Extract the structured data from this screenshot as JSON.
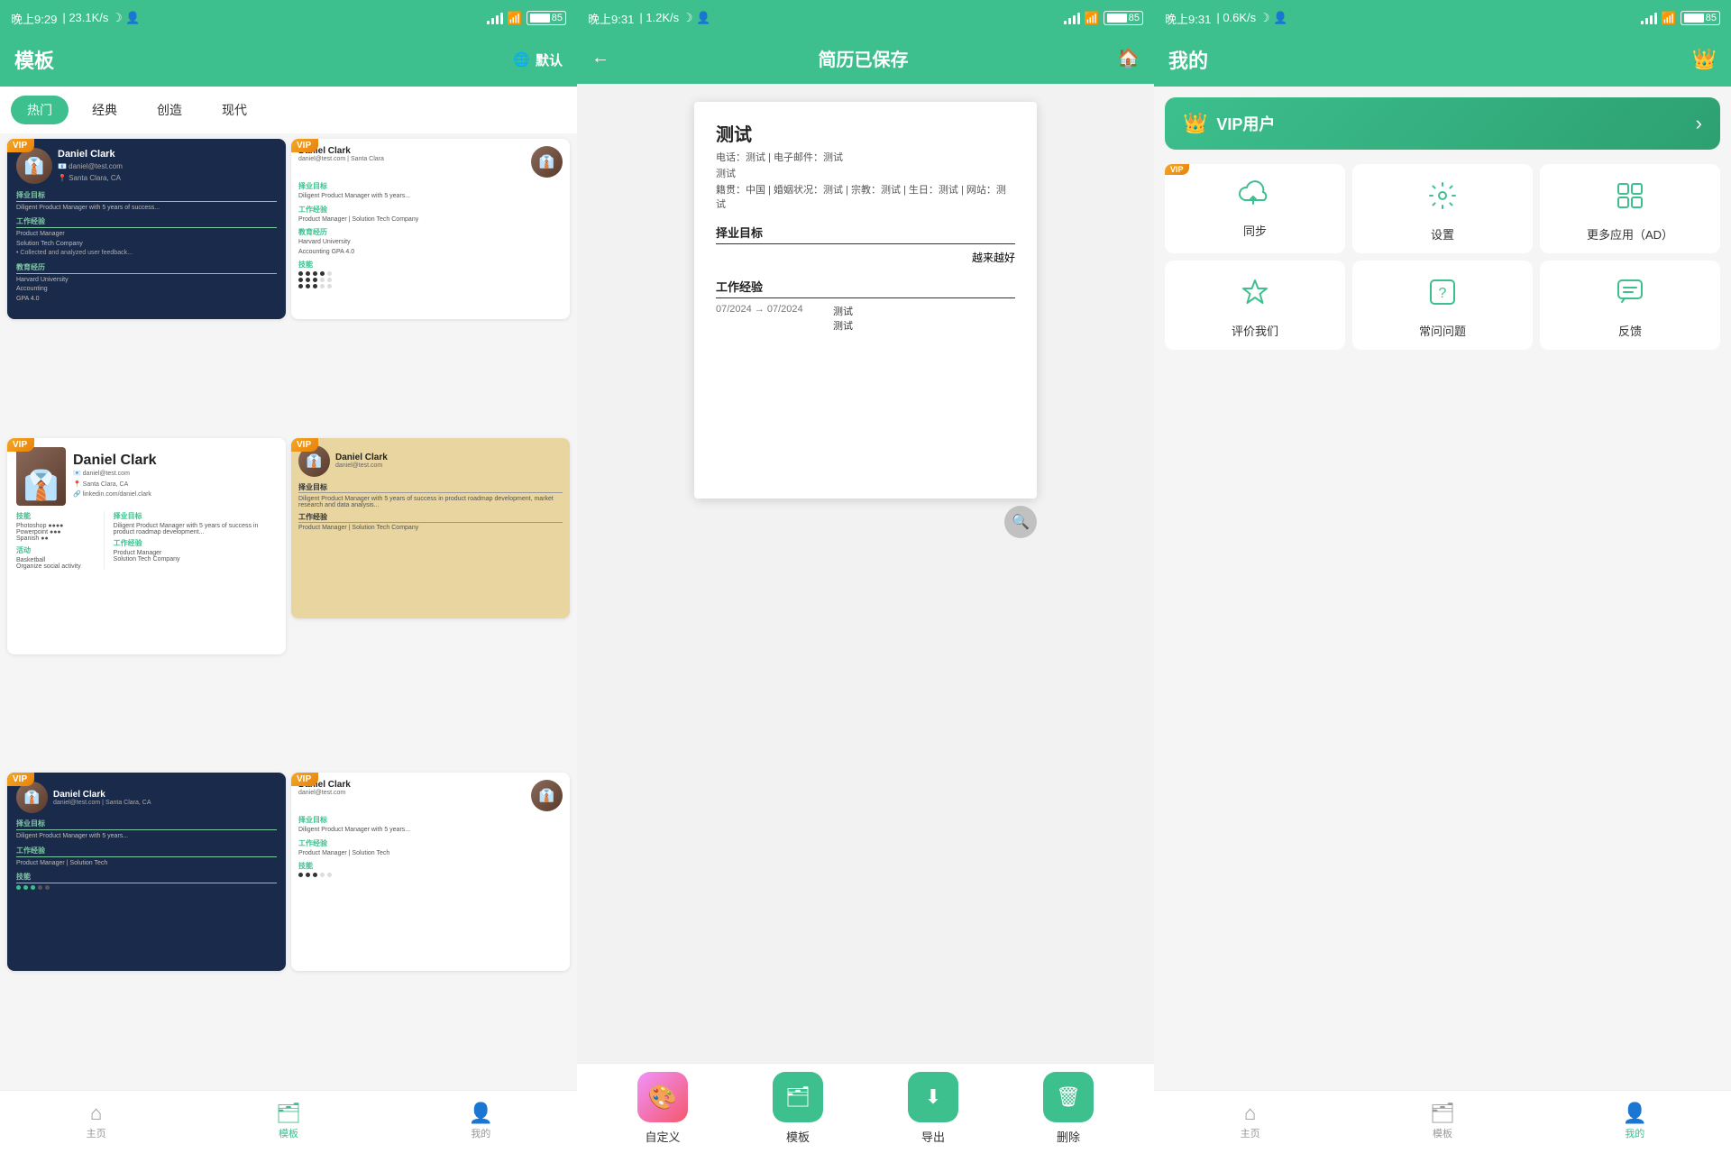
{
  "panel1": {
    "statusBar": {
      "time": "晚上9:29",
      "speed": "23.1K/s",
      "battery": "85"
    },
    "header": {
      "title": "模板",
      "rightLabel": "默认"
    },
    "tabs": [
      "热门",
      "经典",
      "创造",
      "现代"
    ],
    "activeTab": 0,
    "bottomNav": [
      {
        "label": "主页",
        "icon": "⌂",
        "active": false
      },
      {
        "label": "模板",
        "icon": "🗂",
        "active": true
      },
      {
        "label": "我的",
        "icon": "👤",
        "active": false
      }
    ]
  },
  "panel2": {
    "statusBar": {
      "time": "晚上9:31",
      "speed": "1.2K/s",
      "battery": "85"
    },
    "header": {
      "title": "简历已保存"
    },
    "resume": {
      "name": "测试",
      "contact1": "电话：测试 | 电子邮件：测试",
      "contact2": "测试",
      "contact3": "籍贯：中国 | 婚姻状况：测试 | 宗教：测试 | 生日：测试 | 网站：测试",
      "objectiveTitle": "择业目标",
      "objectiveValue": "越来越好",
      "expTitle": "工作经验",
      "expDate": "07/2024 → 07/2024",
      "expJob": "测试",
      "expDetail": "测试"
    },
    "actions": [
      {
        "label": "自定义",
        "icon": "🎨",
        "color": "palette"
      },
      {
        "label": "模板",
        "icon": "🗂",
        "color": "template"
      },
      {
        "label": "导出",
        "icon": "⬇",
        "color": "export"
      },
      {
        "label": "删除",
        "icon": "🗑",
        "color": "delete"
      }
    ]
  },
  "panel3": {
    "statusBar": {
      "time": "晚上9:31",
      "speed": "0.6K/s",
      "battery": "85"
    },
    "header": {
      "title": "我的"
    },
    "vipBanner": "VIP用户",
    "cards": [
      {
        "label": "同步",
        "icon": "cloud",
        "vip": true
      },
      {
        "label": "设置",
        "icon": "gear",
        "vip": false
      },
      {
        "label": "更多应用（AD）",
        "icon": "grid",
        "vip": false
      },
      {
        "label": "评价我们",
        "icon": "star",
        "vip": false
      },
      {
        "label": "常问问题",
        "icon": "question",
        "vip": false
      },
      {
        "label": "反馈",
        "icon": "comment",
        "vip": false
      }
    ],
    "bottomNav": [
      {
        "label": "主页",
        "icon": "⌂",
        "active": false
      },
      {
        "label": "模板",
        "icon": "🗂",
        "active": false
      },
      {
        "label": "我的",
        "icon": "👤",
        "active": true
      }
    ]
  }
}
